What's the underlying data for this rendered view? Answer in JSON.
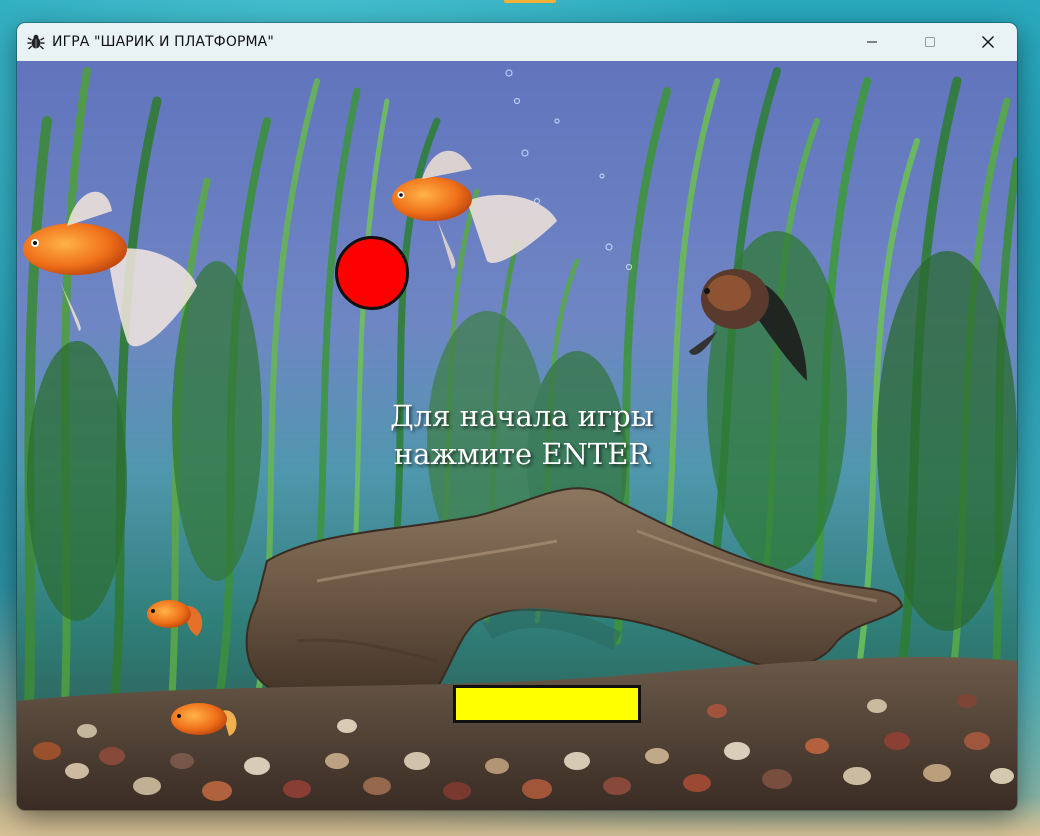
{
  "window": {
    "title": "ИГРА \"ШАРИК И ПЛАТФОРМА\"",
    "icon": "bug-icon",
    "controls": [
      "minimize-icon",
      "maximize-icon",
      "close-icon"
    ]
  },
  "game": {
    "prompt_line1": "Для начала игры",
    "prompt_line2": "нажмите ENTER",
    "ball_color": "#ff0000",
    "paddle_color": "#ffff00",
    "background": "aquarium"
  },
  "colors": {
    "titlebar": "#e9f3f6",
    "outline": "#111111",
    "text": "#ffffff"
  }
}
